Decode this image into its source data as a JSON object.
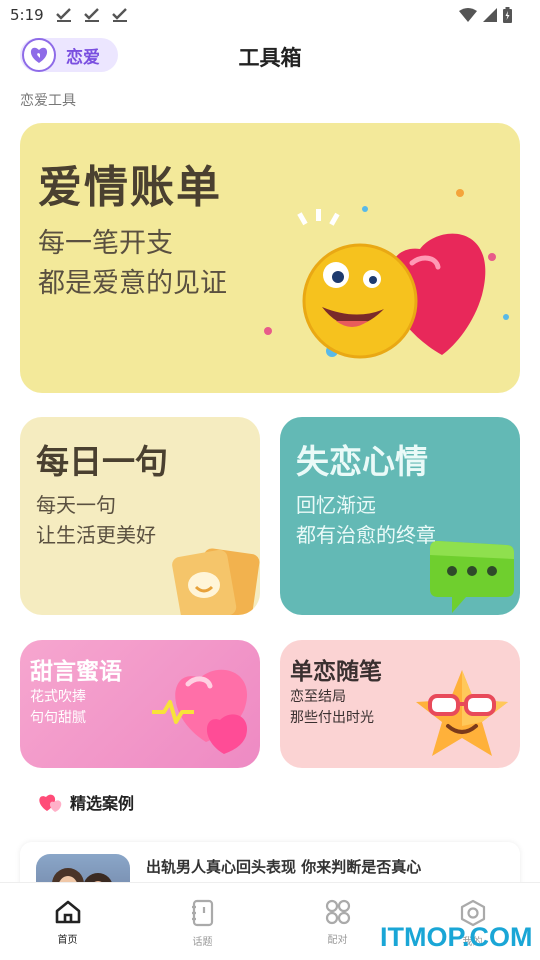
{
  "status_bar": {
    "time": "5:19"
  },
  "header": {
    "brand_label": "恋爱",
    "title": "工具箱"
  },
  "section": {
    "label": "恋爱工具"
  },
  "cards": {
    "bill": {
      "title": "爱情账单",
      "line1": "每一笔开支",
      "line2": "都是爱意的见证"
    },
    "daily": {
      "title": "每日一句",
      "line1": "每天一句",
      "line2": "让生活更美好"
    },
    "heartbreak": {
      "title": "失恋心情",
      "line1": "回忆渐远",
      "line2": "都有治愈的终章"
    },
    "sweet": {
      "title": "甜言蜜语",
      "line1": "花式吹捧",
      "line2": "句句甜腻"
    },
    "crush": {
      "title": "单恋随笔",
      "line1": "恋至结局",
      "line2": "那些付出时光"
    }
  },
  "featured": {
    "title": "精选案例",
    "items": [
      {
        "title": "出轨男人真心回头表现 你来判断是否真心"
      }
    ]
  },
  "tabs": [
    {
      "label": "首页",
      "icon": "home-icon",
      "active": true
    },
    {
      "label": "话题",
      "icon": "notebook-icon",
      "active": false
    },
    {
      "label": "配对",
      "icon": "grid-icon",
      "active": false
    },
    {
      "label": "我的",
      "icon": "settings-icon",
      "active": false
    }
  ],
  "watermark": {
    "text": "ITMOP.COM"
  },
  "colors": {
    "brand": "#7a4fe0",
    "bill_card": "#f3e99a",
    "heartbreak_card": "#63b9b5",
    "sweet_card": "#ee8ac3",
    "crush_card": "#fbd3d3",
    "watermark": "#1aa6d6"
  }
}
